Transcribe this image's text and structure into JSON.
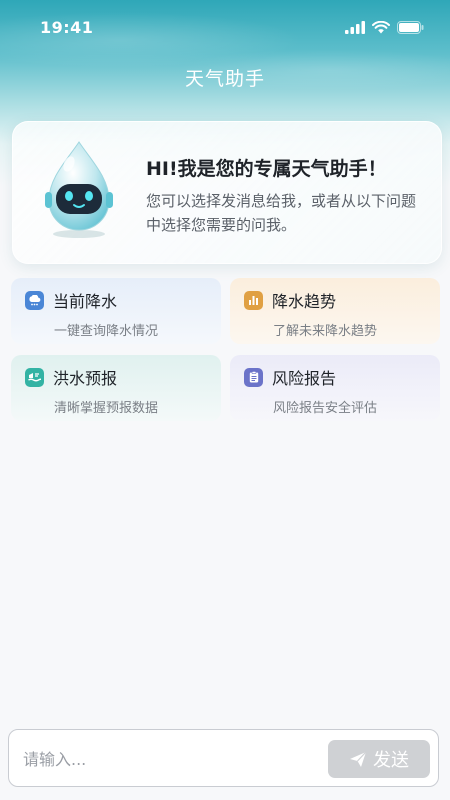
{
  "status": {
    "time": "19:41"
  },
  "header": {
    "title": "天气助手"
  },
  "intro": {
    "title": "HI!我是您的专属天气助手！",
    "description": "您可以选择发消息给我，或者从以下问题中选择您需要的问我。"
  },
  "quick_actions": [
    {
      "title": "当前降水",
      "subtitle": "一键查询降水情况",
      "icon": "rain-cloud-icon",
      "color": "#4a86d6"
    },
    {
      "title": "降水趋势",
      "subtitle": "了解未来降水趋势",
      "icon": "bar-chart-icon",
      "color": "#e0a043"
    },
    {
      "title": "洪水预报",
      "subtitle": "清晰掌握预报数据",
      "icon": "flood-wave-icon",
      "color": "#33b3a4"
    },
    {
      "title": "风险报告",
      "subtitle": "风险报告安全评估",
      "icon": "report-icon",
      "color": "#6b73c9"
    }
  ],
  "composer": {
    "placeholder": "请输入...",
    "send_label": "发送"
  }
}
